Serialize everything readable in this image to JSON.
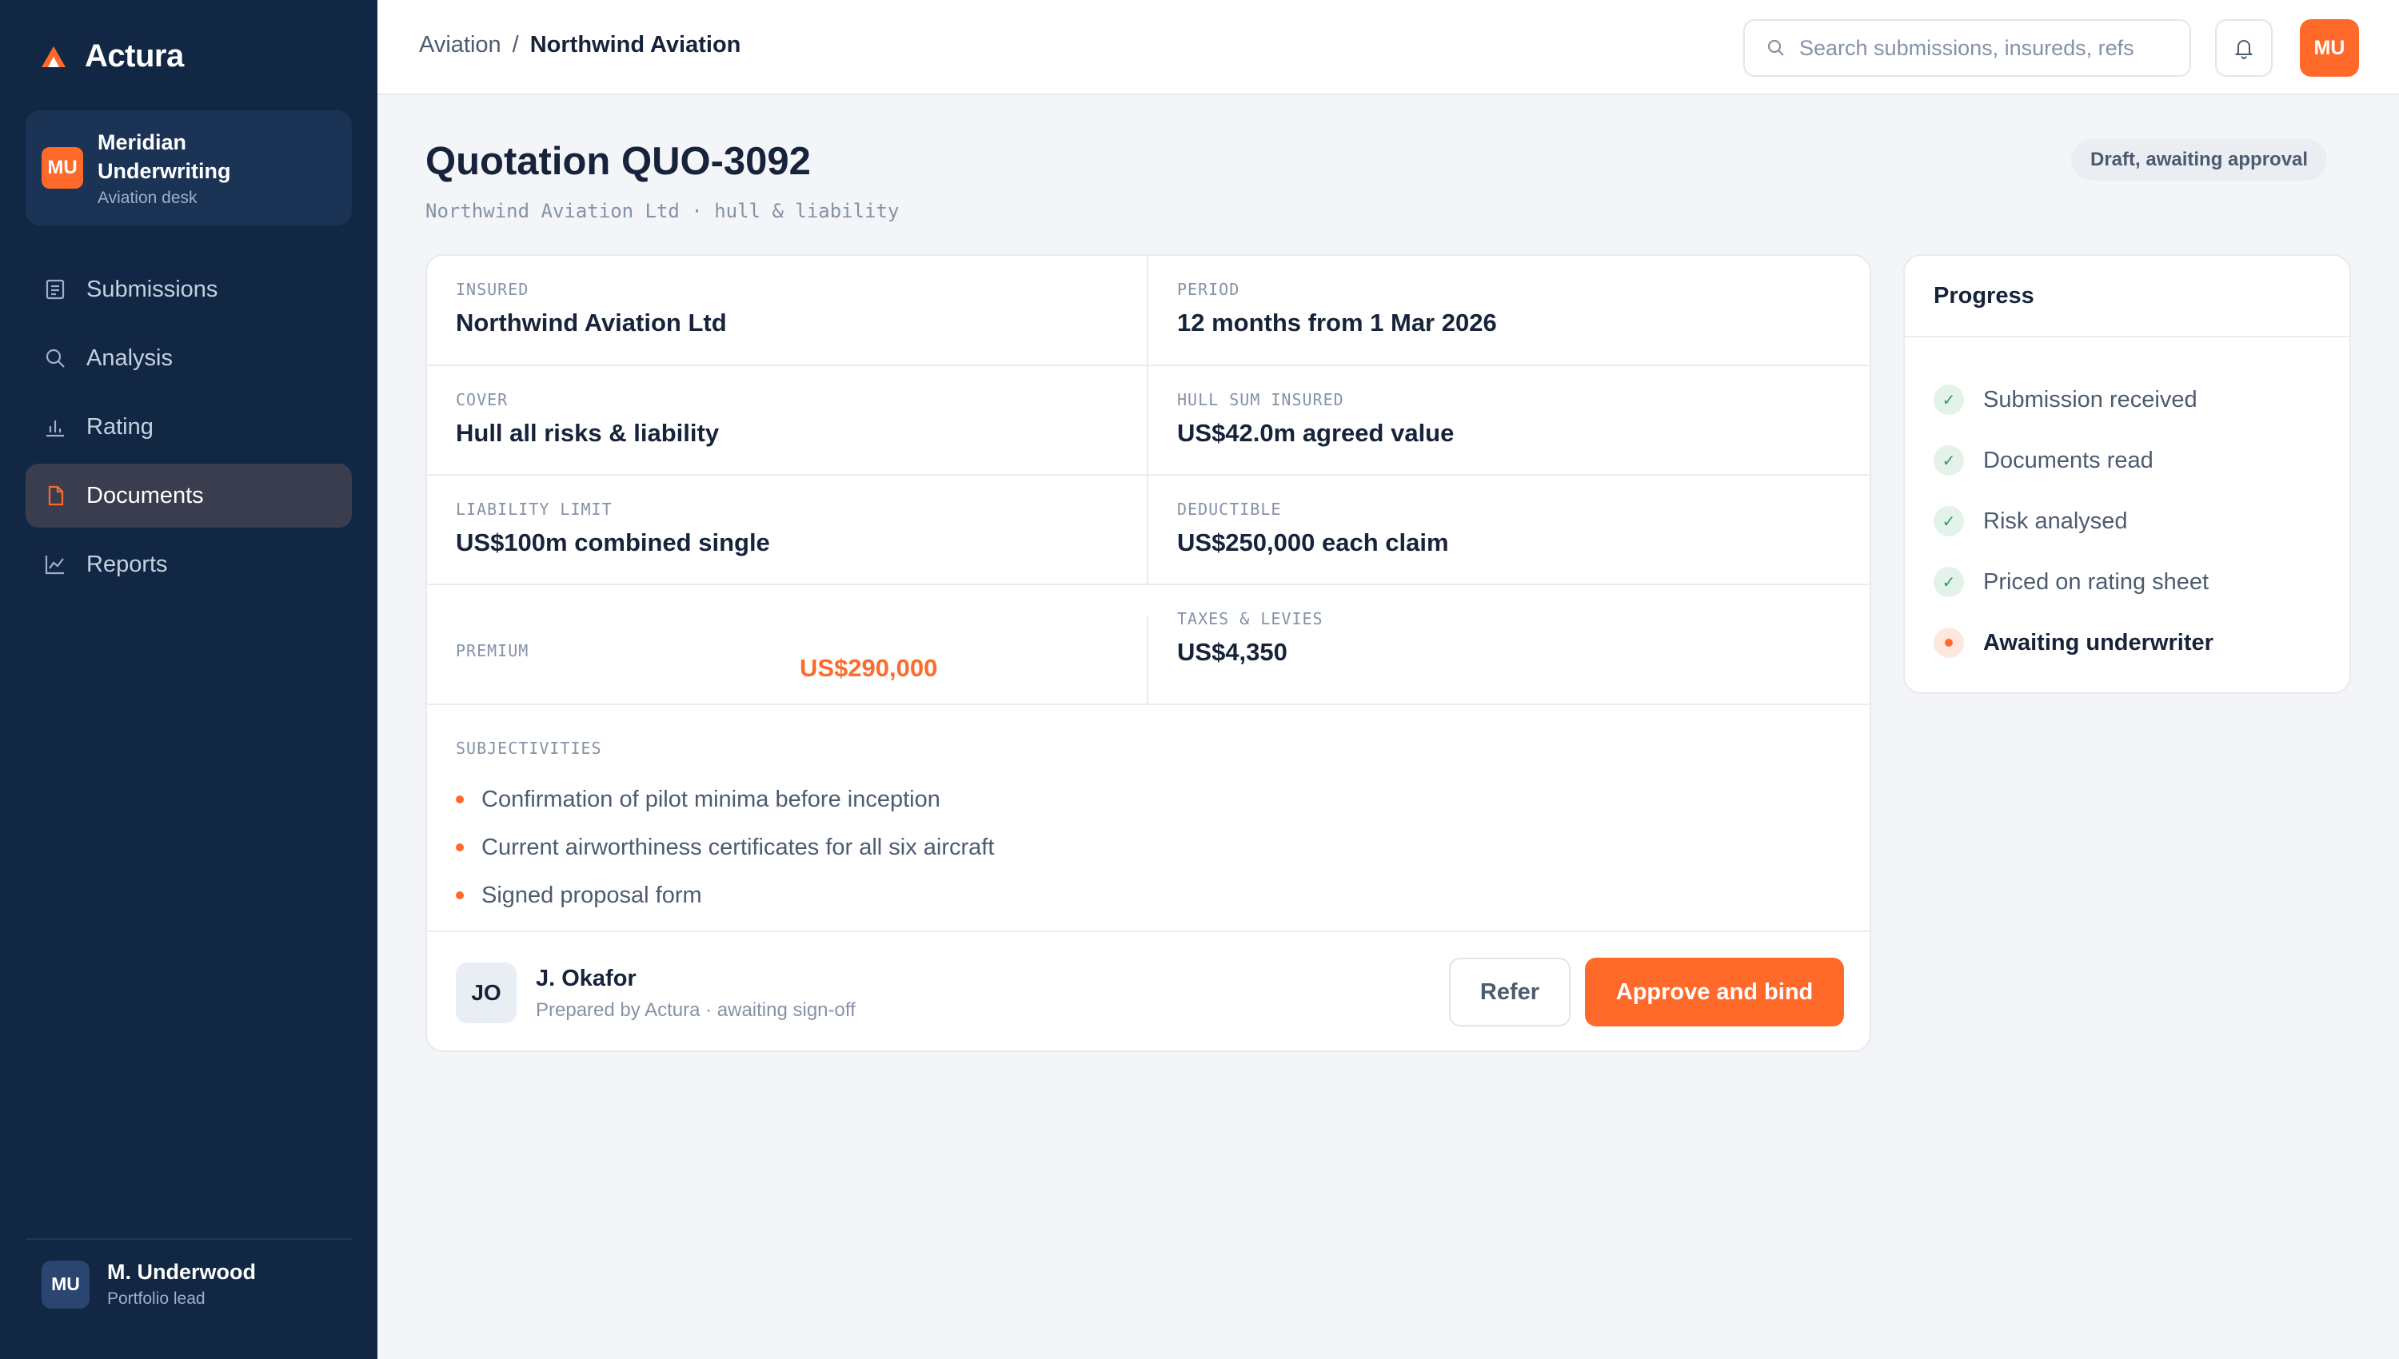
{
  "brand": {
    "name": "Actura",
    "accent": "#ff6a2b",
    "sidebar_bg": "#122744"
  },
  "org": {
    "badge": "MU",
    "name": "Meridian Underwriting",
    "desk": "Aviation desk"
  },
  "nav": {
    "items": [
      {
        "label": "Submissions",
        "icon": "document-list-icon",
        "active": false
      },
      {
        "label": "Analysis",
        "icon": "search-icon",
        "active": false
      },
      {
        "label": "Rating",
        "icon": "bar-chart-icon",
        "active": false
      },
      {
        "label": "Documents",
        "icon": "file-icon",
        "active": true
      },
      {
        "label": "Reports",
        "icon": "line-chart-icon",
        "active": false
      }
    ]
  },
  "user": {
    "badge": "MU",
    "name": "M. Underwood",
    "role": "Portfolio lead"
  },
  "topbar": {
    "breadcrumb": {
      "parent": "Aviation",
      "separator": "/",
      "current": "Northwind Aviation"
    },
    "search_placeholder": "Search submissions, insureds, refs",
    "avatar": "MU"
  },
  "header": {
    "title": "Quotation QUO-3092",
    "subtitle": "Northwind Aviation Ltd · hull & liability",
    "status": "Draft, awaiting approval"
  },
  "quote": {
    "insured": {
      "label": "Insured",
      "value": "Northwind Aviation Ltd"
    },
    "period": {
      "label": "Period",
      "value": "12 months from 1 Mar 2026"
    },
    "cover": {
      "label": "Cover",
      "value": "Hull all risks & liability"
    },
    "hull": {
      "label": "Hull sum insured",
      "value": "US$42.0m agreed value"
    },
    "liability": {
      "label": "Liability limit",
      "value": "US$100m combined single"
    },
    "deductible": {
      "label": "Deductible",
      "value": "US$250,000 each claim"
    },
    "premium": {
      "label": "Premium",
      "value": "US$290,000"
    },
    "taxes": {
      "label": "Taxes & levies",
      "value": "US$4,350"
    },
    "subjectivities": {
      "label": "Subjectivities",
      "items": [
        "Confirmation of pilot minima before inception",
        "Current airworthiness certificates for all six aircraft",
        "Signed proposal form"
      ]
    },
    "preparer": {
      "badge": "JO",
      "name": "J. Okafor",
      "note": "Prepared by Actura · awaiting sign-off"
    },
    "actions": {
      "refer": "Refer",
      "approve": "Approve and bind"
    }
  },
  "progress": {
    "title": "Progress",
    "steps": [
      {
        "label": "Submission received",
        "state": "done"
      },
      {
        "label": "Documents read",
        "state": "done"
      },
      {
        "label": "Risk analysed",
        "state": "done"
      },
      {
        "label": "Priced on rating sheet",
        "state": "done"
      },
      {
        "label": "Awaiting underwriter",
        "state": "current"
      }
    ]
  }
}
